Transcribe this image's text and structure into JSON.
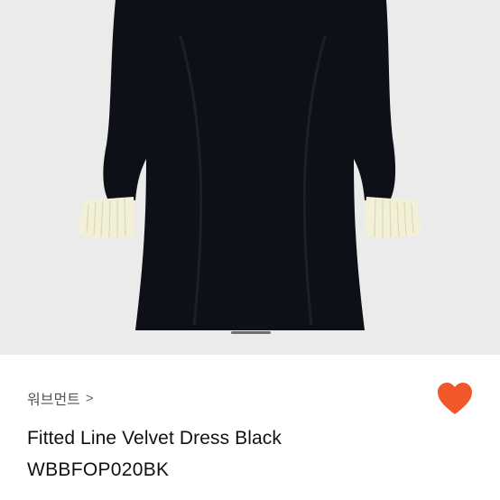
{
  "product": {
    "brand": "워브먼트",
    "brand_chevron": ">",
    "title": "Fitted Line Velvet Dress Black",
    "code": "WBBFOP020BK"
  },
  "gallery": {
    "indicator": "page-indicator"
  },
  "colors": {
    "hero_bg": "#ebebeb",
    "dress": "#0d1117",
    "cuff": "#f2f0d6",
    "heart": "#f0582a"
  }
}
